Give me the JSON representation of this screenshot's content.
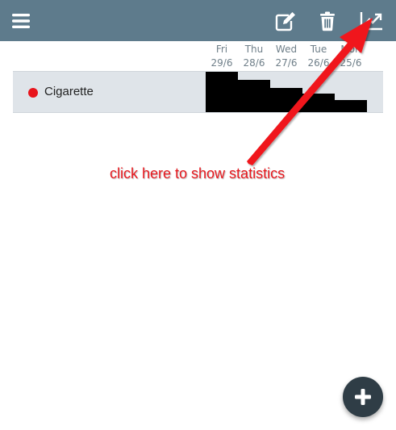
{
  "toolbar": {
    "background": "#5e7b8c",
    "icons": [
      "menu-icon",
      "edit-icon",
      "trash-icon",
      "statistics-icon"
    ]
  },
  "days": [
    {
      "name": "Fri",
      "date": "29/6"
    },
    {
      "name": "Thu",
      "date": "28/6"
    },
    {
      "name": "Wed",
      "date": "27/6"
    },
    {
      "name": "Tue",
      "date": "26/6"
    },
    {
      "name": "Mon",
      "date": "25/6"
    }
  ],
  "habits": [
    {
      "name": "Cigarette",
      "color": "#e8141c",
      "day_levels": [
        1.0,
        0.8,
        0.6,
        0.45,
        0.3
      ]
    }
  ],
  "annotation": {
    "text": "click here to show statistics",
    "color": "#e8181e"
  },
  "fab": {
    "icon": "plus-icon",
    "background": "#2f3d46"
  }
}
